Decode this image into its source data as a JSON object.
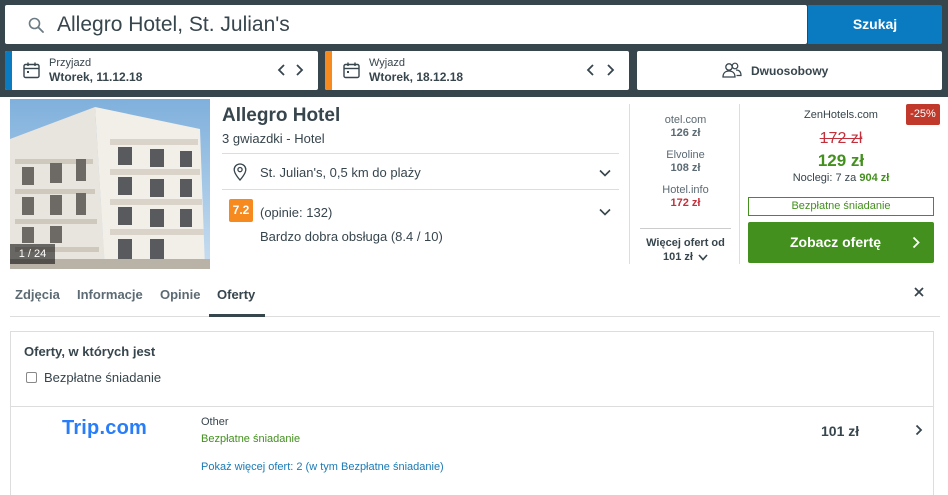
{
  "search": {
    "query": "Allegro Hotel, St. Julian's",
    "button_label": "Szukaj"
  },
  "dates": {
    "checkin_label": "Przyjazd",
    "checkin_value": "Wtorek, 11.12.18",
    "checkout_label": "Wyjazd",
    "checkout_value": "Wtorek, 18.12.18"
  },
  "room": {
    "label": "Dwuosobowy"
  },
  "hotel": {
    "photo_counter": "1 / 24",
    "name": "Allegro Hotel",
    "category": "3 gwiazdki -  Hotel",
    "location": "St. Julian's, 0,5 km do plaży",
    "rating": "7.2",
    "rating_count": "(opinie: 132)",
    "rating_desc": "Bardzo dobra obsługa (8.4 / 10)"
  },
  "alt_deals": [
    {
      "name": "otel.com",
      "price": "126 zł"
    },
    {
      "name": "Elvoline",
      "price": "108 zł"
    },
    {
      "name": "Hotel.info",
      "price": "172 zł"
    }
  ],
  "more_offers": {
    "line1": "Więcej ofert od",
    "line2": "101 zł"
  },
  "best_deal": {
    "provider": "ZenHotels.com",
    "discount": "-25%",
    "old_price": "172 zł",
    "new_price": "129 zł",
    "nights_prefix": "Noclegi: 7 za ",
    "nights_total": "904 zł",
    "breakfast": "Bezpłatne śniadanie",
    "cta": "Zobacz ofertę"
  },
  "tabs": [
    {
      "label": "Zdjęcia"
    },
    {
      "label": "Informacje"
    },
    {
      "label": "Opinie"
    },
    {
      "label": "Oferty"
    }
  ],
  "offers": {
    "title": "Oferty, w których jest",
    "filter_label": "Bezpłatne śniadanie",
    "rows": [
      {
        "provider_logo_main": "Trip",
        "provider_logo_suffix": ".com",
        "room_type": "Other",
        "breakfast": "Bezpłatne śniadanie",
        "more_link": "Pokaż więcej ofert: 2 (w tym Bezpłatne śniadanie)",
        "price": "101 zł"
      }
    ]
  },
  "colors": {
    "topbar": "#37454d",
    "primary_blue": "#0a7ac1",
    "orange": "#f68a1f",
    "green": "#43901e",
    "red": "#c3303b"
  }
}
